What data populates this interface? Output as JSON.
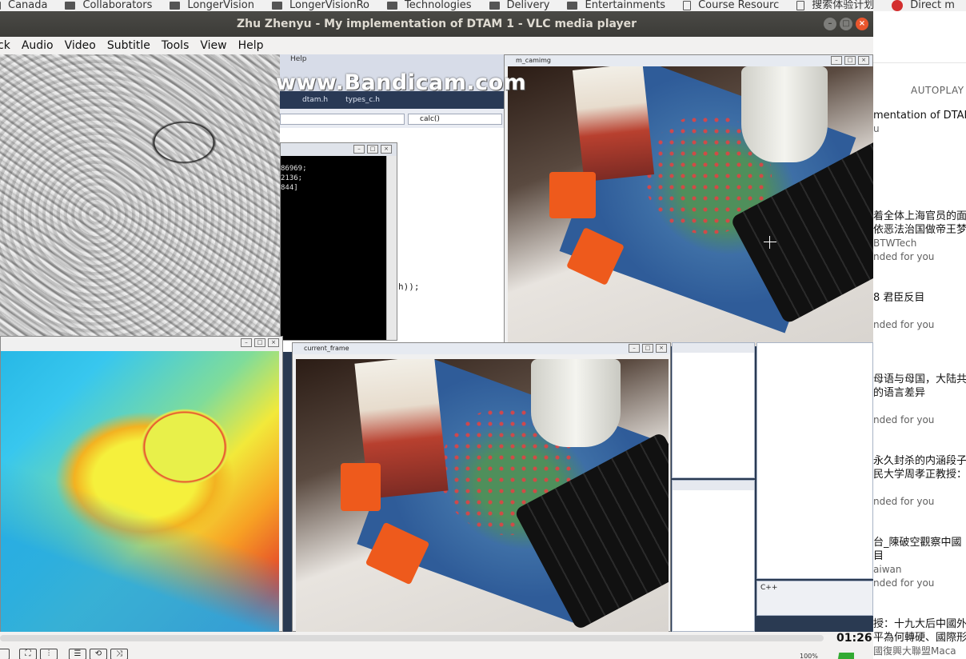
{
  "bookmarks": [
    {
      "label": "Canada",
      "icon": "folder-icon"
    },
    {
      "label": "Collaborators",
      "icon": "folder-icon"
    },
    {
      "label": "LongerVision",
      "icon": "folder-icon"
    },
    {
      "label": "LongerVisionRo",
      "icon": "folder-icon"
    },
    {
      "label": "Technologies",
      "icon": "folder-icon"
    },
    {
      "label": "Delivery",
      "icon": "folder-icon"
    },
    {
      "label": "Entertainments",
      "icon": "folder-icon"
    },
    {
      "label": "Course Resourc",
      "icon": "document-icon"
    },
    {
      "label": "搜索体验计划",
      "icon": "document-icon"
    },
    {
      "label": "Direct m",
      "icon": "red-logo-icon"
    }
  ],
  "vlc": {
    "title": "Zhu Zhenyu - My implementation of DTAM 1 - VLC media player",
    "menu": [
      "ck",
      "Audio",
      "Video",
      "Subtitle",
      "Tools",
      "View",
      "Help"
    ],
    "time": "01:26",
    "volume_label": "100%",
    "controls": [
      "⛶",
      "⫶",
      "☰",
      "⟲",
      "⤨"
    ]
  },
  "video": {
    "watermark": "www.Bandicam.com",
    "ide": {
      "help_label": "Help",
      "tabs": [
        "dtam.h",
        "types_c.h"
      ],
      "function_combo": "calc()",
      "code_call": "h));"
    },
    "console": {
      "lines": [
        "86969;",
        "2136;",
        "844]"
      ]
    },
    "cam_window_title": "m_camimg",
    "frame_window_title": "current_frame",
    "language_label": "C++"
  },
  "sidebar": {
    "autoplay_label": "AUTOPLAY",
    "items": [
      {
        "title": "mentation of DTAM",
        "sub": "u"
      },
      {
        "title": "着全体上海官员的面",
        "title2": "依恶法治国做帝王梦",
        "channel": "BTWTech",
        "sub": "nded for you"
      },
      {
        "title": "8 君臣反目",
        "sub": "nded for you"
      },
      {
        "title": "母语与母国，大陆共",
        "title2": "的语言差异",
        "sub": "nded for you"
      },
      {
        "title": "永久封杀的内涵段子",
        "title2": "民大学周孝正教授：",
        "sub": "nded for you"
      },
      {
        "title": "台_陳破空觀察中國",
        "title2": "目",
        "channel": "aiwan",
        "sub": "nded for you"
      },
      {
        "title": "授：十九大后中國外",
        "title2": "平為何轉硬、國際形",
        "channel": "國復興大聯盟Maca"
      }
    ]
  }
}
